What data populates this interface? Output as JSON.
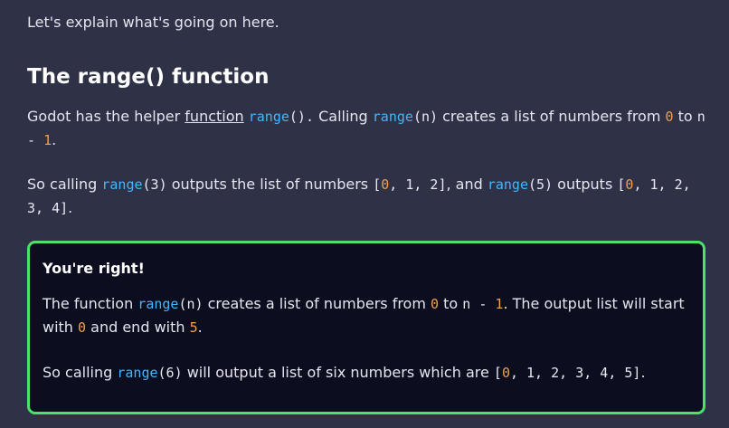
{
  "intro": "Let's explain what's going on here.",
  "heading": "The range() function",
  "para1": {
    "t1": "Godot has the helper ",
    "link": "function",
    "t2": " ",
    "code1_kw": "range",
    "code1_rest": "().",
    "t3": " Calling ",
    "code2_kw": "range",
    "code2_rest": "(n)",
    "t4": " creates a list of numbers from ",
    "zero": "0",
    "t5": " to ",
    "n_minus": "n - ",
    "one": "1",
    "t6": "."
  },
  "para2": {
    "t1": "So calling ",
    "c1_kw": "range",
    "c1_rest": "(3)",
    "t2": " outputs the list of numbers ",
    "list1_open": "[",
    "list1_first": "0",
    "list1_rest": ", 1, 2]",
    "t3": ", and ",
    "c2_kw": "range",
    "c2_rest": "(5)",
    "t4": " outputs ",
    "list2_open": "[",
    "list2_first": "0",
    "list2_rest": ", 1, 2, 3, 4]",
    "t5": "."
  },
  "callout": {
    "title": "You're right!",
    "p1": {
      "t1": "The function ",
      "c_kw": "range",
      "c_rest": "(n)",
      "t2": " creates a list of numbers from ",
      "zero": "0",
      "t3": " to ",
      "n_minus": "n - ",
      "one": "1",
      "t4": ". The output list will start with ",
      "zero2": "0",
      "t5": " and end with ",
      "five": "5",
      "t6": "."
    },
    "p2": {
      "t1": "So calling ",
      "c_kw": "range",
      "c_rest": "(6)",
      "t2": " will output a list of six numbers which are ",
      "list_open": "[",
      "list_first": "0",
      "list_rest": ", 1, 2, 3, 4, 5]",
      "t3": "."
    }
  },
  "colors": {
    "background": "#2f3147",
    "callout_bg": "#0c0d1e",
    "callout_border": "#4be26a",
    "keyword": "#41b6ff",
    "number": "#f0a04a"
  }
}
